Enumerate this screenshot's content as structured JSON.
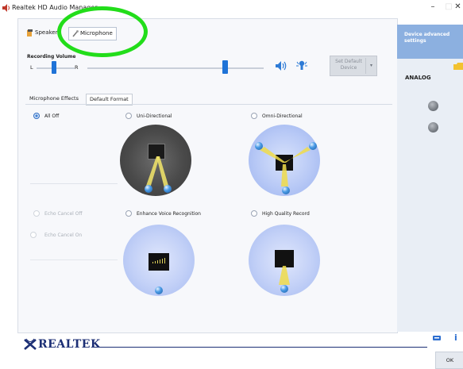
{
  "window": {
    "title": "Realtek HD Audio Manager",
    "minimize": "–",
    "maximize": "□",
    "close": "✕"
  },
  "device_tabs": [
    {
      "label": "Speakers"
    },
    {
      "label": "Microphone"
    }
  ],
  "recording": {
    "label": "Recording Volume",
    "left": "L",
    "right": "R",
    "balance_position": 0.45,
    "volume_level": 0.78
  },
  "set_default": {
    "label": "Set Default Device",
    "arrow": "▾"
  },
  "sub_tabs": [
    {
      "label": "Microphone Effects"
    },
    {
      "label": "Default Format"
    }
  ],
  "effects": {
    "all_off": "All Off",
    "uni": "Uni-Directional",
    "omni": "Omni-Directional",
    "echo_off": "Echo Cancel Off",
    "echo_on": "Echo Cancel On",
    "enhance": "Enhance Voice Recognition",
    "hq": "High Quality Record"
  },
  "right_panel": {
    "device_advanced": "Device advanced settings",
    "analog": "ANALOG"
  },
  "brand": "REALTEK",
  "ok": "OK",
  "colors": {
    "accent": "#1f73d7",
    "header": "#8cb0e0",
    "highlight": "#22dd1a",
    "brand": "#1c2f75"
  },
  "icons": {
    "app": "speaker-app-icon",
    "speakers_tab": "speaker-icon",
    "microphone_tab": "microphone-icon",
    "mute": "speaker-volume-icon",
    "boost": "microphone-boost-icon",
    "info": "info-icon",
    "folder": "folder-icon"
  }
}
